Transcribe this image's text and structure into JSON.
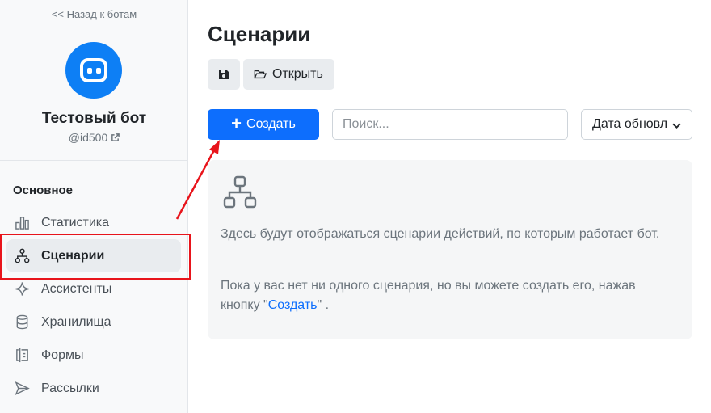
{
  "sidebar": {
    "back_link": "<< Назад к ботам",
    "bot_name": "Тестовый бот",
    "bot_id": "@id500",
    "section_title": "Основное",
    "items": [
      {
        "label": "Статистика",
        "icon": "bar-chart-icon"
      },
      {
        "label": "Сценарии",
        "icon": "flow-icon",
        "active": true
      },
      {
        "label": "Ассистенты",
        "icon": "sparkle-icon"
      },
      {
        "label": "Хранилища",
        "icon": "database-icon"
      },
      {
        "label": "Формы",
        "icon": "form-icon"
      },
      {
        "label": "Рассылки",
        "icon": "send-icon"
      }
    ]
  },
  "main": {
    "title": "Сценарии",
    "toolbar": {
      "open_label": "Открыть"
    },
    "create_label": "Создать",
    "search_placeholder": "Поиск...",
    "sort_label": "Дата обновления",
    "empty": {
      "text1": "Здесь будут отображаться сценарии действий, по которым работает бот.",
      "text2_before": "Пока у вас нет ни одного сценария, но вы можете создать его, нажав кнопку \"",
      "text2_link": "Создать",
      "text2_after": "\" ."
    }
  },
  "colors": {
    "accent": "#0d6efd",
    "avatar": "#0d7ff5",
    "annotation": "#e8141b"
  }
}
